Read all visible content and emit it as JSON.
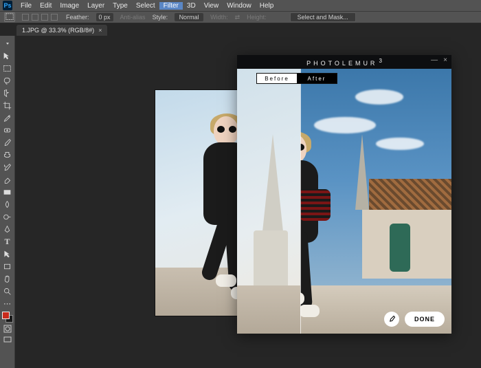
{
  "menu": {
    "items": [
      "File",
      "Edit",
      "Image",
      "Layer",
      "Type",
      "Select",
      "Filter",
      "3D",
      "View",
      "Window",
      "Help"
    ],
    "active": "Filter"
  },
  "options_bar": {
    "feather_label": "Feather:",
    "feather_value": "0 px",
    "anti_alias": "Anti-alias",
    "style_label": "Style:",
    "style_value": "Normal",
    "width_label": "Width:",
    "height_label": "Height:",
    "select_mask": "Select and Mask..."
  },
  "tab": {
    "title": "1.JPG @ 33.3% (RGB/8#)",
    "close": "×"
  },
  "tooltips": {
    "move": "move-tool",
    "marquee": "marquee-tool",
    "lasso": "lasso-tool",
    "wand": "quick-select-tool",
    "crop": "crop-tool",
    "eyedropper": "eyedropper-tool",
    "heal": "healing-brush-tool",
    "brush": "brush-tool",
    "stamp": "clone-stamp-tool",
    "history": "history-brush-tool",
    "eraser": "eraser-tool",
    "gradient": "gradient-tool",
    "blur": "blur-tool",
    "dodge": "dodge-tool",
    "pen": "pen-tool",
    "type": "type-tool",
    "path": "path-select-tool",
    "shape": "rectangle-shape-tool",
    "hand": "hand-tool",
    "zoom": "zoom-tool"
  },
  "panel": {
    "brand": "PHOTOLEMUR",
    "brand_sup": "3",
    "before": "Before",
    "after": "After",
    "done": "DONE",
    "minimize": "—",
    "close": "×"
  }
}
